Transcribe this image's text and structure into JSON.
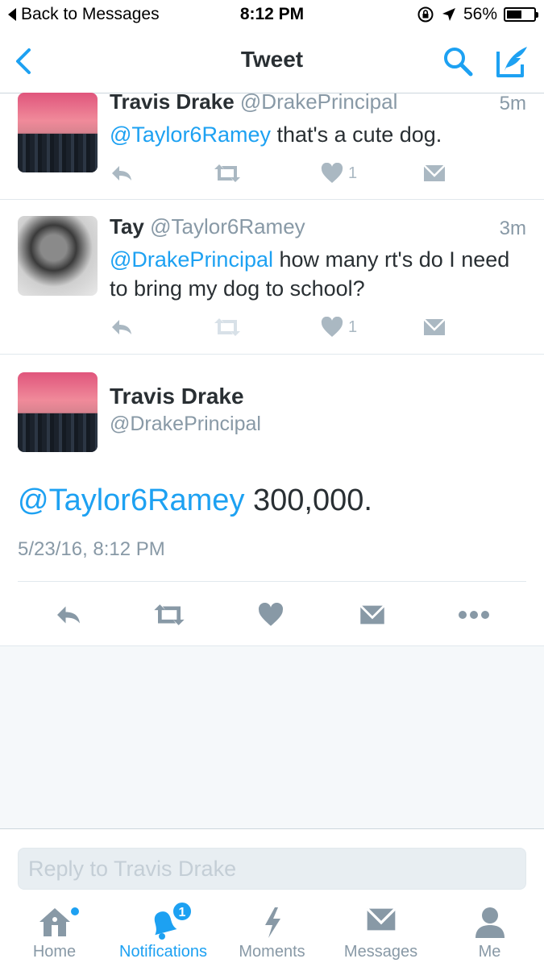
{
  "status_bar": {
    "back_label": "Back to Messages",
    "time": "8:12 PM",
    "battery": "56%",
    "battery_level": 0.56
  },
  "nav": {
    "title": "Tweet",
    "icons": [
      "chevron-left-icon",
      "search-icon",
      "compose-icon"
    ]
  },
  "tweets": [
    {
      "name": "Travis Drake",
      "handle": "@DrakePrincipal",
      "time": "5m",
      "mention": "@Taylor6Ramey",
      "text": " that's a cute dog.",
      "likes": "1"
    },
    {
      "name": "Tay",
      "handle": "@Taylor6Ramey",
      "time": "3m",
      "mention": "@DrakePrincipal",
      "text": " how many rt's do I need to bring my dog to school?",
      "likes": "1"
    }
  ],
  "main_tweet": {
    "name": "Travis Drake",
    "handle": "@DrakePrincipal",
    "mention": "@Taylor6Ramey",
    "text": " 300,000.",
    "date": "5/23/16, 8:12 PM"
  },
  "reply": {
    "placeholder": "Reply to Travis Drake"
  },
  "tabs": [
    {
      "label": "Home",
      "icon": "home-icon",
      "active": false
    },
    {
      "label": "Notifications",
      "icon": "bell-icon",
      "active": true,
      "badge": "1"
    },
    {
      "label": "Moments",
      "icon": "lightning-icon",
      "active": false
    },
    {
      "label": "Messages",
      "icon": "envelope-icon",
      "active": false
    },
    {
      "label": "Me",
      "icon": "person-icon",
      "active": false
    }
  ],
  "colors": {
    "accent": "#1da1f2",
    "icon_gray": "#8899a6",
    "light_icon": "#aab8c2",
    "text": "#292f33"
  }
}
